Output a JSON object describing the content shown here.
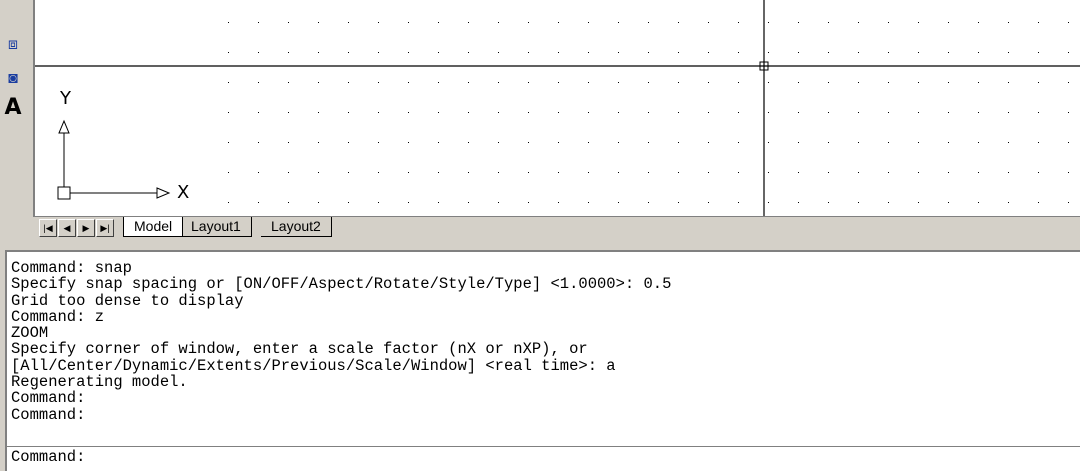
{
  "toolbar": {
    "items": [
      {
        "icon": "properties-icon"
      },
      {
        "icon": "hatch-icon"
      },
      {
        "icon": "region-icon"
      },
      {
        "icon": "multiline-text-icon",
        "glyph": "A"
      }
    ]
  },
  "drawing": {
    "ucs": {
      "y_label": "Y",
      "x_label": "X"
    }
  },
  "tabs": {
    "nav": [
      "first-tab",
      "previous-tab",
      "next-tab",
      "last-tab"
    ],
    "items": [
      {
        "label": "Model",
        "active": true
      },
      {
        "label": "Layout1",
        "active": false
      },
      {
        "label": "Layout2",
        "active": false
      }
    ]
  },
  "command_window": {
    "history": [
      "Command: snap",
      "Specify snap spacing or [ON/OFF/Aspect/Rotate/Style/Type] <1.0000>: 0.5",
      "Grid too dense to display",
      "Command: z",
      "ZOOM",
      "Specify corner of window, enter a scale factor (nX or nXP), or",
      "[All/Center/Dynamic/Extents/Previous/Scale/Window] <real time>: a",
      "Regenerating model.",
      "Command:",
      "Command:"
    ],
    "prompt": "Command:"
  }
}
